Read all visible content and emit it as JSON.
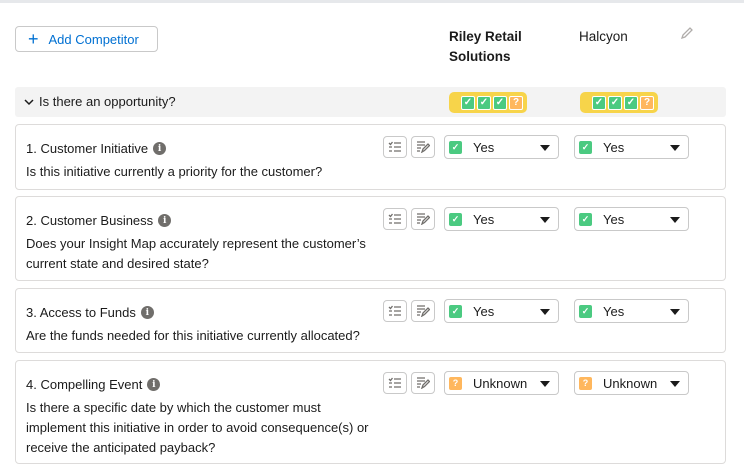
{
  "toolbar": {
    "add_competitor_label": "Add Competitor",
    "add_icon": "plus-icon"
  },
  "competitors": [
    {
      "name": "Riley Retail Solutions"
    },
    {
      "name": "Halcyon"
    }
  ],
  "edit_icon": "pencil-icon",
  "section": {
    "title": "Is there an opportunity?",
    "expanded": true,
    "summaries": [
      {
        "competitor": "Riley Retail Solutions",
        "marks": [
          "check",
          "check",
          "check",
          "unknown"
        ]
      },
      {
        "competitor": "Halcyon",
        "marks": [
          "check",
          "check",
          "check",
          "unknown"
        ]
      }
    ]
  },
  "questions": [
    {
      "title": "1. Customer Initiative",
      "text": "Is this initiative currently a priority for the customer?",
      "answers": [
        "Yes",
        "Yes"
      ]
    },
    {
      "title": "2. Customer Business",
      "text": "Does your Insight Map accurately represent the customer’s current state and desired state?",
      "answers": [
        "Yes",
        "Yes"
      ]
    },
    {
      "title": "3. Access to Funds",
      "text": "Are the funds needed for this initiative currently allocated?",
      "answers": [
        "Yes",
        "Yes"
      ]
    },
    {
      "title": "4. Compelling Event",
      "text": "Is there a specific date by which the customer must implement this initiative in order to avoid consequence(s) or receive the anticipated payback?",
      "answers": [
        "Unknown",
        "Unknown"
      ]
    }
  ],
  "status_glyphs": {
    "check": "✓",
    "unknown": "?"
  },
  "colors": {
    "accent": "#0070d2",
    "check_green": "#4bca81",
    "unknown_orange": "#ffb75d",
    "summary_yellow": "#f7d44a"
  }
}
